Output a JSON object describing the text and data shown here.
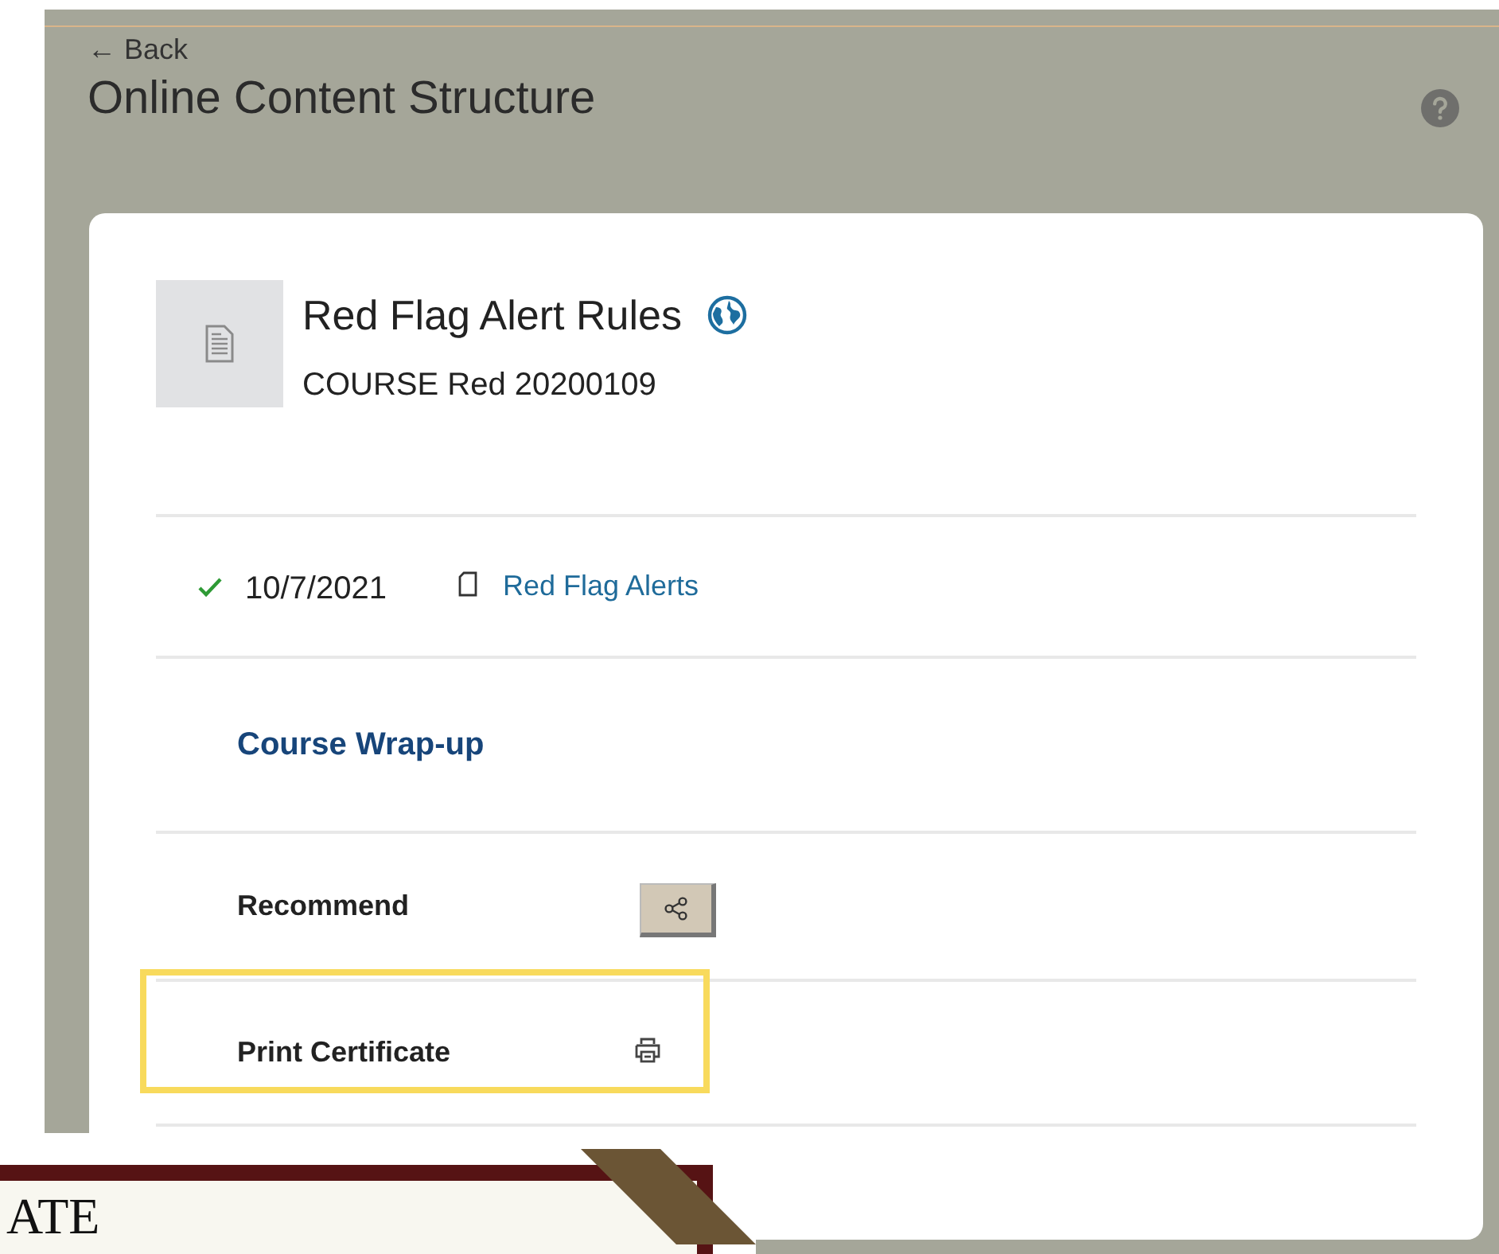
{
  "header": {
    "back_label": "← Back",
    "title": "Online Content Structure"
  },
  "course": {
    "title": "Red Flag Alert Rules",
    "subtitle": "COURSE Red 20200109"
  },
  "completion": {
    "completed": true,
    "date": "10/7/2021",
    "link": "Red Flag Alerts"
  },
  "section_title": "Course Wrap-up",
  "actions": [
    {
      "kind": "share",
      "label": "Recommend",
      "highlighted": false
    },
    {
      "kind": "print",
      "label": "Print Certificate",
      "highlighted": true
    }
  ],
  "certificate_preview": {
    "text": "ATE"
  }
}
